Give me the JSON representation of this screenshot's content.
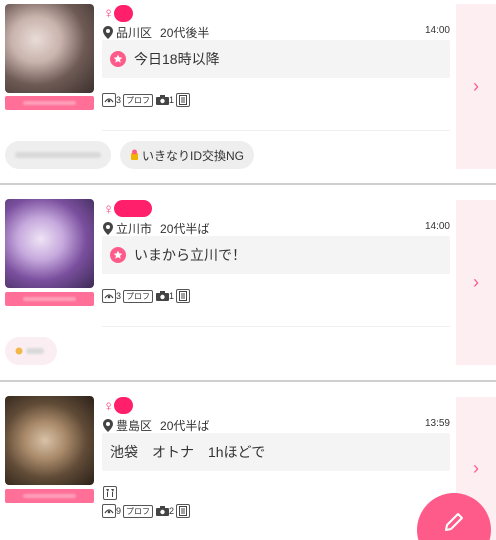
{
  "colors": {
    "accent": "#ff5b8a",
    "gender": "#ff3d7f",
    "avatar_tag": "#ff6f97",
    "side_bg": "#fdeef1"
  },
  "posts": [
    {
      "gender_symbol": "♀",
      "area": "品川区",
      "age": "20代後半",
      "time": "14:00",
      "message": "今日18時以降",
      "footprints": "3",
      "profile_label": "プロフ",
      "photos": "1",
      "arrow": "›",
      "chips": [
        "いきなりID交換NG"
      ]
    },
    {
      "gender_symbol": "♀",
      "area": "立川市",
      "age": "20代半ば",
      "time": "14:00",
      "message": "いまから立川で！",
      "footprints": "3",
      "profile_label": "プロフ",
      "photos": "1",
      "arrow": "›"
    },
    {
      "gender_symbol": "♀",
      "area": "豊島区",
      "age": "20代半ば",
      "time": "13:59",
      "message": "池袋　オトナ　1hほどで",
      "footprints": "9",
      "profile_label": "プロフ",
      "photos": "2",
      "arrow": "›"
    }
  ]
}
